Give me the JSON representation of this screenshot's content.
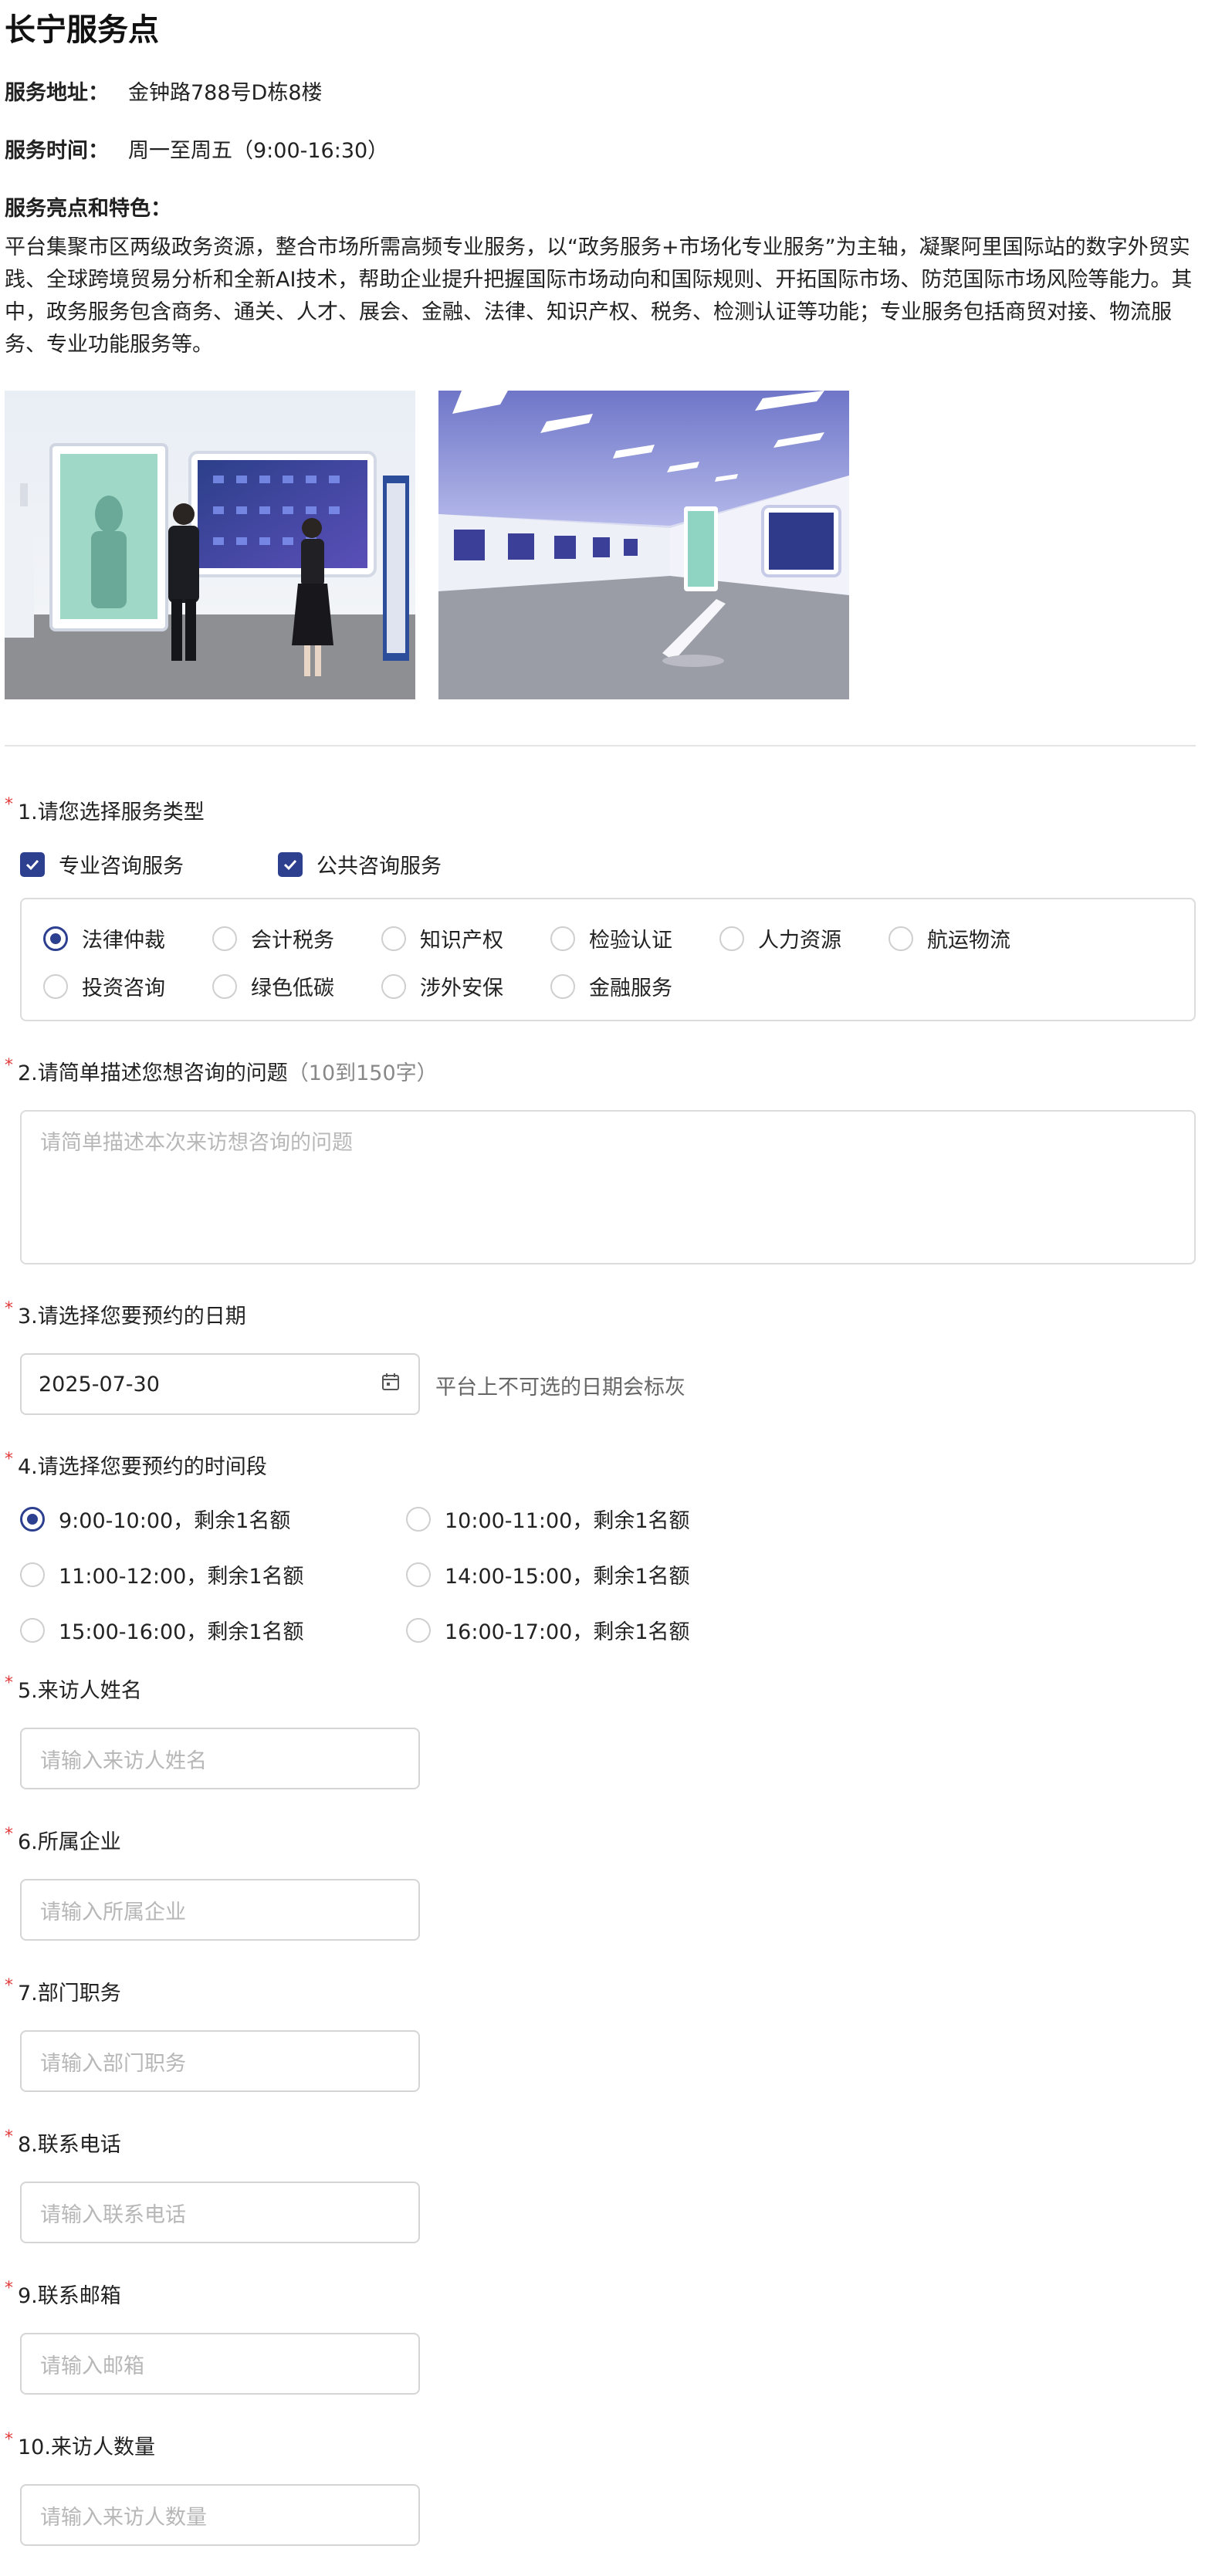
{
  "page_title": "长宁服务点",
  "address": {
    "label": "服务地址：",
    "value": "金钟路788号D栋8楼"
  },
  "hours": {
    "label": "服务时间：",
    "value": "周一至周五（9:00-16:30）"
  },
  "highlights_title": "服务亮点和特色：",
  "highlights_text": "平台集聚市区两级政务资源，整合市场所需高频专业服务，以“政务服务+市场化专业服务”为主轴，凝聚阿里国际站的数字外贸实践、全球跨境贸易分析和全新AI技术，帮助企业提升把握国际市场动向和国际规则、开拓国际市场、防范国际市场风险等能力。其中，政务服务包含商务、通关、人才、展会、金融、法律、知识产权、税务、检测认证等功能；专业服务包括商贸对接、物流服务、专业功能服务等。",
  "q1": {
    "label": "1.请您选择服务类型",
    "checks": [
      "专业咨询服务",
      "公共咨询服务"
    ],
    "options": [
      "法律仲裁",
      "会计税务",
      "知识产权",
      "检验认证",
      "人力资源",
      "航运物流",
      "投资咨询",
      "绿色低碳",
      "涉外安保",
      "金融服务"
    ],
    "selected": "法律仲裁"
  },
  "q2": {
    "label": "2.请简单描述您想咨询的问题",
    "hint": "（10到150字）",
    "placeholder": "请简单描述本次来访想咨询的问题"
  },
  "q3": {
    "label": "3.请选择您要预约的日期",
    "value": "2025-07-30",
    "note": "平台上不可选的日期会标灰"
  },
  "q4": {
    "label": "4.请选择您要预约的时间段",
    "slots": [
      "9:00-10:00，剩余1名额",
      "10:00-11:00，剩余1名额",
      "11:00-12:00，剩余1名额",
      "14:00-15:00，剩余1名额",
      "15:00-16:00，剩余1名额",
      "16:00-17:00，剩余1名额"
    ],
    "selected": "9:00-10:00，剩余1名额"
  },
  "q5": {
    "label": "5.来访人姓名",
    "placeholder": "请输入来访人姓名"
  },
  "q6": {
    "label": "6.所属企业",
    "placeholder": "请输入所属企业"
  },
  "q7": {
    "label": "7.部门职务",
    "placeholder": "请输入部门职务"
  },
  "q8": {
    "label": "8.联系电话",
    "placeholder": "请输入联系电话"
  },
  "q9": {
    "label": "9.联系邮箱",
    "placeholder": "请输入邮箱"
  },
  "q10": {
    "label": "10.来访人数量",
    "placeholder": "请输入来访人数量"
  },
  "required_mark": "*",
  "colors": {
    "accent": "#2d3f8f",
    "required": "#e03a3a"
  }
}
